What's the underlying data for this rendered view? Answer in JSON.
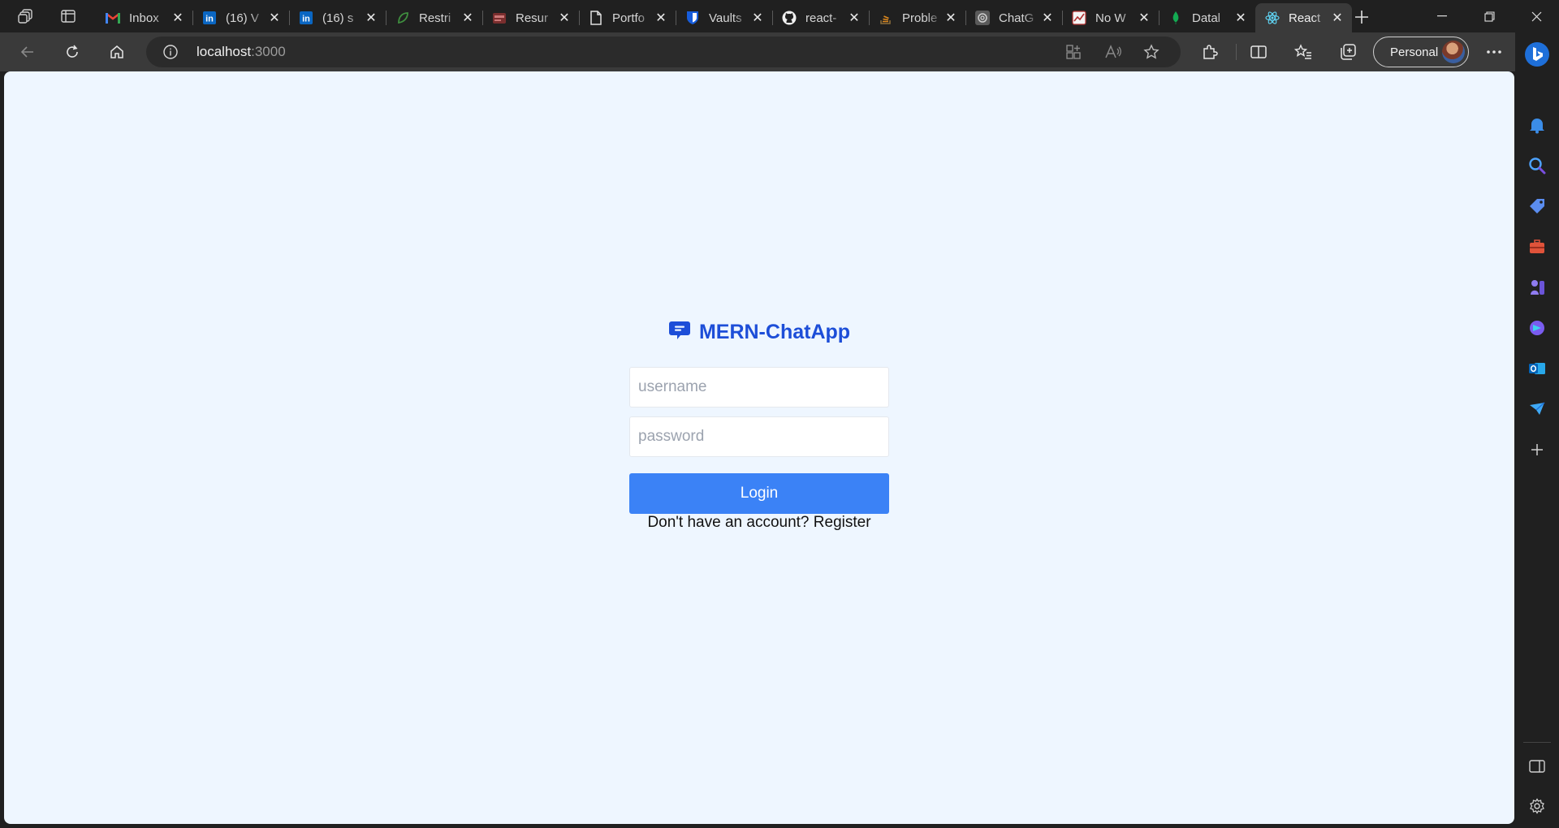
{
  "browser": {
    "tabs": [
      {
        "title": "Inbox",
        "icon": "gmail-icon",
        "active": false
      },
      {
        "title": "(16) V",
        "icon": "linkedin-icon",
        "active": false
      },
      {
        "title": "(16) s",
        "icon": "linkedin-icon",
        "active": false
      },
      {
        "title": "Restri",
        "icon": "leaf-icon",
        "active": false
      },
      {
        "title": "Resur",
        "icon": "pdf-icon",
        "active": false
      },
      {
        "title": "Portfo",
        "icon": "document-icon",
        "active": false
      },
      {
        "title": "Vaults",
        "icon": "bitwarden-icon",
        "active": false
      },
      {
        "title": "react-",
        "icon": "github-icon",
        "active": false
      },
      {
        "title": "Proble",
        "icon": "stack-icon",
        "active": false
      },
      {
        "title": "ChatG",
        "icon": "openai-icon",
        "active": false
      },
      {
        "title": "No W",
        "icon": "chart-icon",
        "active": false
      },
      {
        "title": "Datal",
        "icon": "mongodb-icon",
        "active": false
      },
      {
        "title": "React",
        "icon": "react-icon",
        "active": true
      }
    ],
    "address": {
      "host": "localhost",
      "port": ":3000"
    },
    "profile_label": "Personal"
  },
  "page": {
    "brand": "MERN-ChatApp",
    "username_placeholder": "username",
    "password_placeholder": "password",
    "login_label": "Login",
    "register_prompt": "Don't have an account?",
    "register_link": "Register"
  },
  "colors": {
    "brand": "#1d4ed8",
    "button": "#3b82f6",
    "page_bg": "#eef6ff"
  }
}
